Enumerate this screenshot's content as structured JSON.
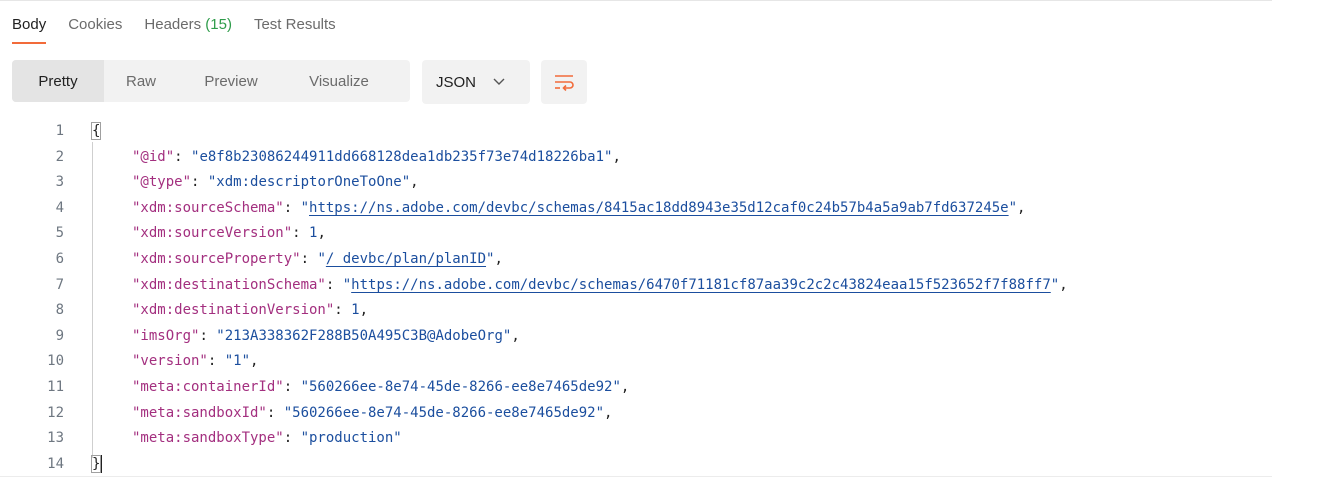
{
  "tabs": [
    {
      "label": "Body"
    },
    {
      "label": "Cookies"
    },
    {
      "label": "Headers",
      "count": "(15)"
    },
    {
      "label": "Test Results"
    }
  ],
  "view_modes": [
    "Pretty",
    "Raw",
    "Preview",
    "Visualize"
  ],
  "format": {
    "selected": "JSON"
  },
  "icons": {
    "chevron": "chevron-down-icon",
    "wrap": "wrap-lines-icon"
  },
  "colors": {
    "accent": "#f26b3a",
    "key": "#a32f7f",
    "string": "#1b4e9e",
    "count": "#2e9c4a"
  },
  "code": {
    "line_numbers": [
      "1",
      "2",
      "3",
      "4",
      "5",
      "6",
      "7",
      "8",
      "9",
      "10",
      "11",
      "12",
      "13",
      "14"
    ],
    "open_brace": "{",
    "close_brace": "}",
    "entries": [
      {
        "key": "\"@id\"",
        "value": "\"e8f8b23086244911dd668128dea1db235f73e74d18226ba1\"",
        "comma": ","
      },
      {
        "key": "\"@type\"",
        "value": "\"xdm:descriptorOneToOne\"",
        "comma": ","
      },
      {
        "key": "\"xdm:sourceSchema\"",
        "value_pre": "\"",
        "link": "https://ns.adobe.com/devbc/schemas/8415ac18dd8943e35d12caf0c24b57b4a5a9ab7fd637245e",
        "value_post": "\"",
        "comma": ","
      },
      {
        "key": "\"xdm:sourceVersion\"",
        "value": "1",
        "comma": ","
      },
      {
        "key": "\"xdm:sourceProperty\"",
        "value_pre": "\"",
        "link": "/_devbc/plan/planID",
        "value_post": "\"",
        "comma": ","
      },
      {
        "key": "\"xdm:destinationSchema\"",
        "value_pre": "\"",
        "link": "https://ns.adobe.com/devbc/schemas/6470f71181cf87aa39c2c2c43824eaa15f523652f7f88ff7",
        "value_post": "\"",
        "comma": ","
      },
      {
        "key": "\"xdm:destinationVersion\"",
        "value": "1",
        "comma": ","
      },
      {
        "key": "\"imsOrg\"",
        "value": "\"213A338362F288B50A495C3B@AdobeOrg\"",
        "comma": ","
      },
      {
        "key": "\"version\"",
        "value": "\"1\"",
        "comma": ","
      },
      {
        "key": "\"meta:containerId\"",
        "value": "\"560266ee-8e74-45de-8266-ee8e7465de92\"",
        "comma": ","
      },
      {
        "key": "\"meta:sandboxId\"",
        "value": "\"560266ee-8e74-45de-8266-ee8e7465de92\"",
        "comma": ","
      },
      {
        "key": "\"meta:sandboxType\"",
        "value": "\"production\"",
        "comma": ""
      }
    ]
  }
}
